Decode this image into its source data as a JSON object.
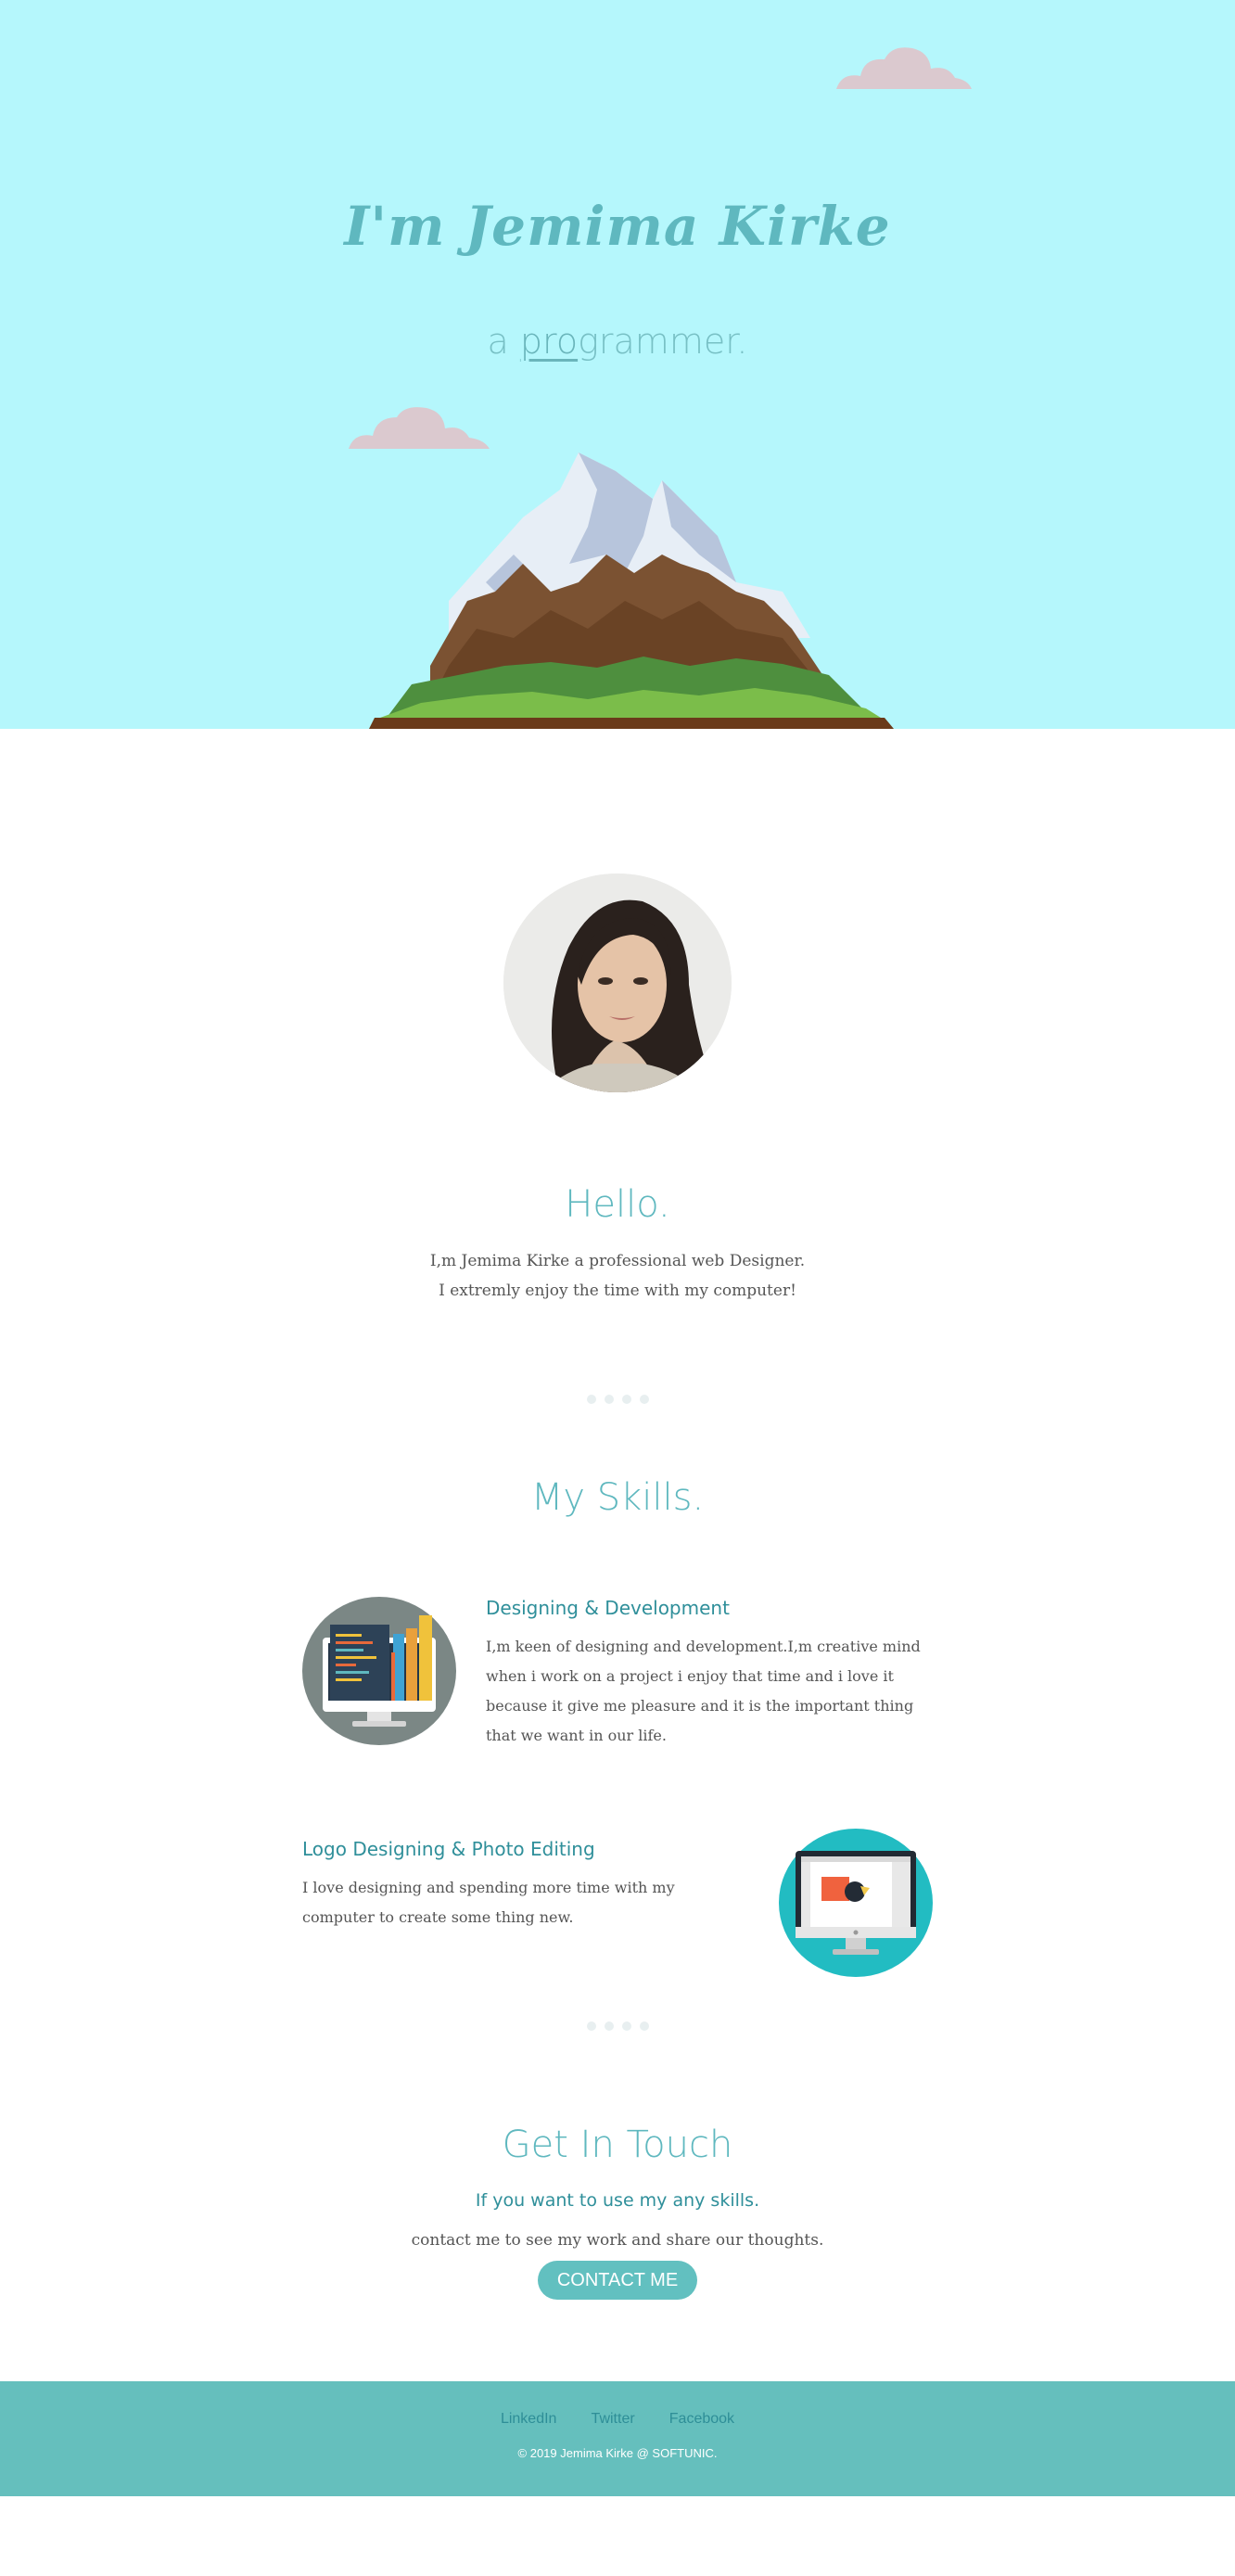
{
  "hero": {
    "title": "I'm Jemima Kirke",
    "subtitle_prefix": "a ",
    "subtitle_typed": "pro",
    "subtitle_rest": "grammer.",
    "background": "#b5f7fc"
  },
  "about": {
    "heading": "Hello.",
    "line1": "I,m Jemima Kirke a professional web Designer.",
    "line2": "I extremly enjoy the time with my computer!"
  },
  "skills": {
    "heading": "My Skills.",
    "items": [
      {
        "title": "Designing & Development",
        "text": "I,m keen of designing and development.I,m creative mind when i work on a project i enjoy that time and i love it because it give me pleasure and it is the important thing that we want in our life.",
        "icon": "code-monitor-icon"
      },
      {
        "title": "Logo Designing & Photo Editing",
        "text": "I love designing and spending more time with my computer to create some thing new.",
        "icon": "design-monitor-icon"
      }
    ]
  },
  "contact": {
    "heading": "Get In Touch",
    "subheading": "If you want to use my any skills.",
    "text": "contact me to see my work and share our thoughts.",
    "button": "CONTACT ME"
  },
  "footer": {
    "links": [
      "LinkedIn",
      "Twitter",
      "Facebook"
    ],
    "copyright": "© 2019 Jemima Kirke @ SOFTUNIC."
  },
  "colors": {
    "accent": "#5fb8bf",
    "footer": "#65bfbd",
    "button": "#62c0c0"
  }
}
